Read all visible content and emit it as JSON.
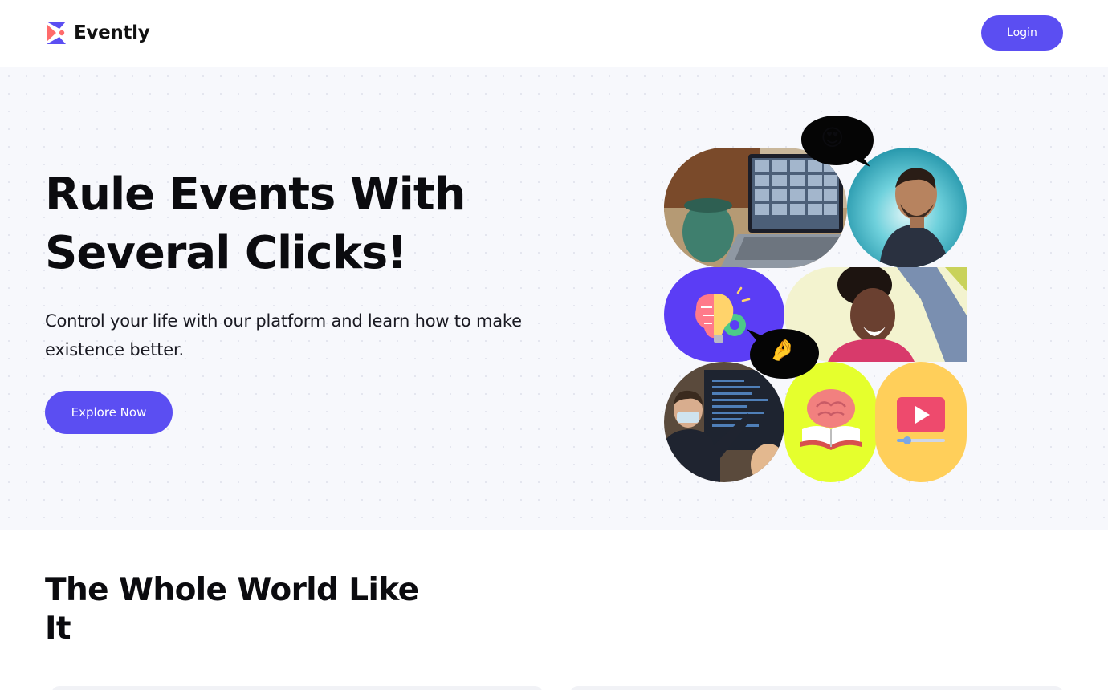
{
  "header": {
    "brand_name": "Evently",
    "login_label": "Login",
    "logo_icon": "evently-logo-icon"
  },
  "hero": {
    "title": "Rule Events With Several Clicks!",
    "subtitle": "Control your life with our platform and learn how to make existence better.",
    "cta_label": "Explore Now",
    "bubble_emoji_1": "😍",
    "bubble_emoji_2": "🤌",
    "collage_icons": [
      "laptop-video-call-photo",
      "smiling-man-photo",
      "brain-lightbulb-icon",
      "laughing-woman-photo",
      "teacher-presenting-photo",
      "brain-book-icon",
      "video-player-icon"
    ]
  },
  "section2": {
    "title": "The Whole World Like It"
  },
  "colors": {
    "accent": "#5b4ef2",
    "hero_bg": "#f7f8fc",
    "brain_tile": "#5b3df5",
    "book_tile": "#e5ff2d",
    "video_tile": "#ffcf5a"
  }
}
